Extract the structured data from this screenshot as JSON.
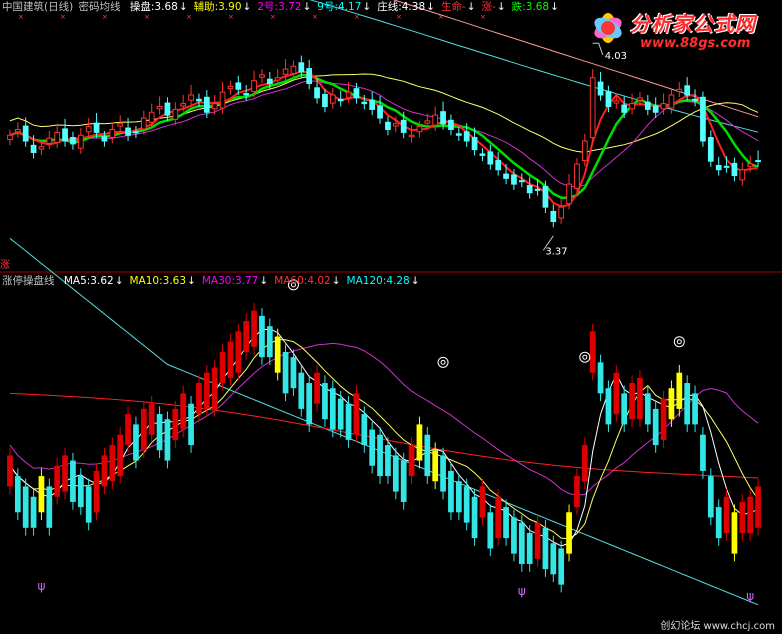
{
  "top_panel": {
    "title": "中国建筑(日线)",
    "indicator_name": "密码均线",
    "fields": [
      {
        "label": "操盘:3.68",
        "color": "#ffffff"
      },
      {
        "label": "辅助:3.90",
        "color": "#ffff00"
      },
      {
        "label": "2号:3.72",
        "color": "#ff00ff"
      },
      {
        "label": "9号:4.17",
        "color": "#00ffff"
      },
      {
        "label": "庄线:4.38",
        "color": "#ffffff"
      },
      {
        "label": "生命-",
        "color": "#ff3333"
      },
      {
        "label": "涨-",
        "color": "#ff3333"
      },
      {
        "label": "跌:3.68",
        "color": "#00ff00"
      }
    ],
    "annotation_high": "4.03",
    "annotation_low": "3.37",
    "side_label": "涨"
  },
  "bottom_panel": {
    "indicator_name": "涨停操盘线",
    "fields": [
      {
        "label": "MA5:3.62",
        "color": "#ffffff"
      },
      {
        "label": "MA10:3.63",
        "color": "#ffff00"
      },
      {
        "label": "MA30:3.77",
        "color": "#ff00ff"
      },
      {
        "label": "MA60:4.02",
        "color": "#ff3333"
      },
      {
        "label": "MA120:4.28",
        "color": "#00ffff"
      }
    ],
    "marker_symbol": "ψ"
  },
  "logo": {
    "title": "分析家公式网",
    "url": "www.88gs.com"
  },
  "watermark": "创幻论坛 www.chcj.com",
  "colors": {
    "up": "#ff3232",
    "down": "#54ffff",
    "bottom_up": "#dd0000",
    "bottom_down": "#33e6e6",
    "highlight": "#ffff00",
    "ma_green": "#00dd00",
    "ma_red": "#ff2020",
    "ma_purple": "#cc33cc",
    "ma_yellow": "#ffff66",
    "ma_cyan": "#55dddd",
    "ma_pink": "#ff9999",
    "ma_white": "#ffffff",
    "divider": "#aa0000"
  },
  "chart_data": {
    "type": "candlestick",
    "candles_count": 96,
    "price_range": [
      3.37,
      4.03
    ],
    "extremes": [
      {
        "label": "4.03",
        "kind": "high"
      },
      {
        "label": "3.37",
        "kind": "low"
      }
    ],
    "top_closes": [
      3.72,
      3.74,
      3.7,
      3.66,
      3.68,
      3.71,
      3.73,
      3.7,
      3.69,
      3.72,
      3.75,
      3.73,
      3.7,
      3.74,
      3.76,
      3.72,
      3.73,
      3.78,
      3.8,
      3.82,
      3.79,
      3.81,
      3.83,
      3.86,
      3.84,
      3.8,
      3.83,
      3.87,
      3.89,
      3.88,
      3.86,
      3.91,
      3.93,
      3.9,
      3.92,
      3.95,
      3.96,
      3.94,
      3.9,
      3.85,
      3.82,
      3.86,
      3.84,
      3.87,
      3.85,
      3.83,
      3.81,
      3.78,
      3.74,
      3.76,
      3.73,
      3.72,
      3.75,
      3.77,
      3.79,
      3.76,
      3.74,
      3.72,
      3.7,
      3.67,
      3.65,
      3.62,
      3.6,
      3.57,
      3.55,
      3.56,
      3.52,
      3.53,
      3.47,
      3.42,
      3.47,
      3.55,
      3.62,
      3.7,
      3.92,
      3.86,
      3.82,
      3.84,
      3.8,
      3.83,
      3.85,
      3.81,
      3.8,
      3.83,
      3.86,
      3.88,
      3.86,
      3.84,
      3.7,
      3.63,
      3.6,
      3.61,
      3.58,
      3.6,
      3.62,
      3.63
    ],
    "bottom_values": [
      3.66,
      3.62,
      3.6,
      3.58,
      3.62,
      3.6,
      3.64,
      3.66,
      3.65,
      3.62,
      3.6,
      3.63,
      3.66,
      3.68,
      3.7,
      3.74,
      3.72,
      3.75,
      3.76,
      3.74,
      3.73,
      3.75,
      3.78,
      3.76,
      3.8,
      3.82,
      3.83,
      3.86,
      3.88,
      3.9,
      3.92,
      3.94,
      3.93,
      3.91,
      3.89,
      3.86,
      3.85,
      3.82,
      3.8,
      3.82,
      3.8,
      3.79,
      3.77,
      3.76,
      3.78,
      3.74,
      3.71,
      3.7,
      3.68,
      3.66,
      3.65,
      3.68,
      3.72,
      3.7,
      3.67,
      3.66,
      3.63,
      3.61,
      3.6,
      3.58,
      3.6,
      3.55,
      3.58,
      3.56,
      3.54,
      3.53,
      3.51,
      3.53,
      3.52,
      3.49,
      3.48,
      3.55,
      3.62,
      3.68,
      3.9,
      3.84,
      3.79,
      3.82,
      3.78,
      3.8,
      3.81,
      3.78,
      3.75,
      3.77,
      3.79,
      3.82,
      3.8,
      3.78,
      3.7,
      3.62,
      3.56,
      3.58,
      3.55,
      3.57,
      3.58,
      3.6
    ],
    "bottom_range": [
      3.35,
      4.0
    ],
    "legend": [
      "MA5",
      "MA10",
      "MA30",
      "MA60",
      "MA120"
    ]
  }
}
